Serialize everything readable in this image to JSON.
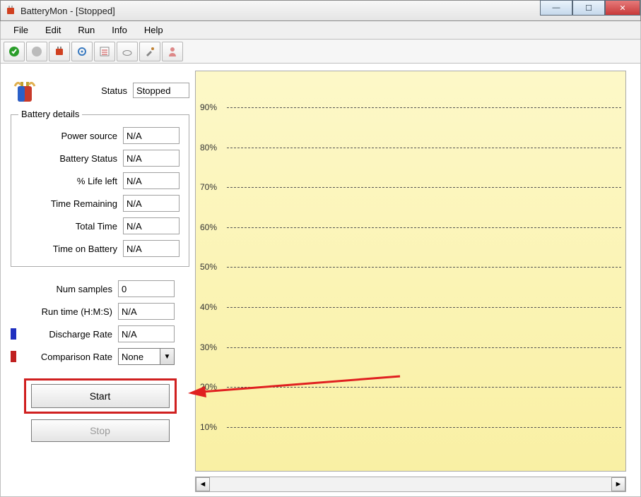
{
  "window": {
    "title": "BatteryMon - [Stopped]"
  },
  "menu": {
    "items": [
      "File",
      "Edit",
      "Run",
      "Info",
      "Help"
    ]
  },
  "toolbar_icons": [
    "start-icon",
    "stop-icon",
    "battery-icon",
    "config-icon",
    "checklist-icon",
    "cloud-icon",
    "tool-icon",
    "person-icon"
  ],
  "status": {
    "label": "Status",
    "value": "Stopped"
  },
  "battery_details": {
    "title": "Battery details",
    "rows": [
      {
        "label": "Power source",
        "value": "N/A"
      },
      {
        "label": "Battery Status",
        "value": "N/A"
      },
      {
        "label": "% Life left",
        "value": "N/A"
      },
      {
        "label": "Time Remaining",
        "value": "N/A"
      },
      {
        "label": "Total Time",
        "value": "N/A"
      },
      {
        "label": "Time on Battery",
        "value": "N/A"
      }
    ]
  },
  "extra": {
    "num_samples": {
      "label": "Num samples",
      "value": "0"
    },
    "run_time": {
      "label": "Run time (H:M:S)",
      "value": "N/A"
    },
    "discharge": {
      "label": "Discharge Rate",
      "value": "N/A"
    },
    "comparison": {
      "label": "Comparison Rate",
      "value": "None"
    }
  },
  "buttons": {
    "start": "Start",
    "stop": "Stop"
  },
  "chart_data": {
    "type": "line",
    "title": "",
    "xlabel": "",
    "ylabel": "%",
    "ylim": [
      0,
      100
    ],
    "ytick_labels": [
      "90%",
      "80%",
      "70%",
      "60%",
      "50%",
      "40%",
      "30%",
      "20%",
      "10%"
    ],
    "series": []
  }
}
